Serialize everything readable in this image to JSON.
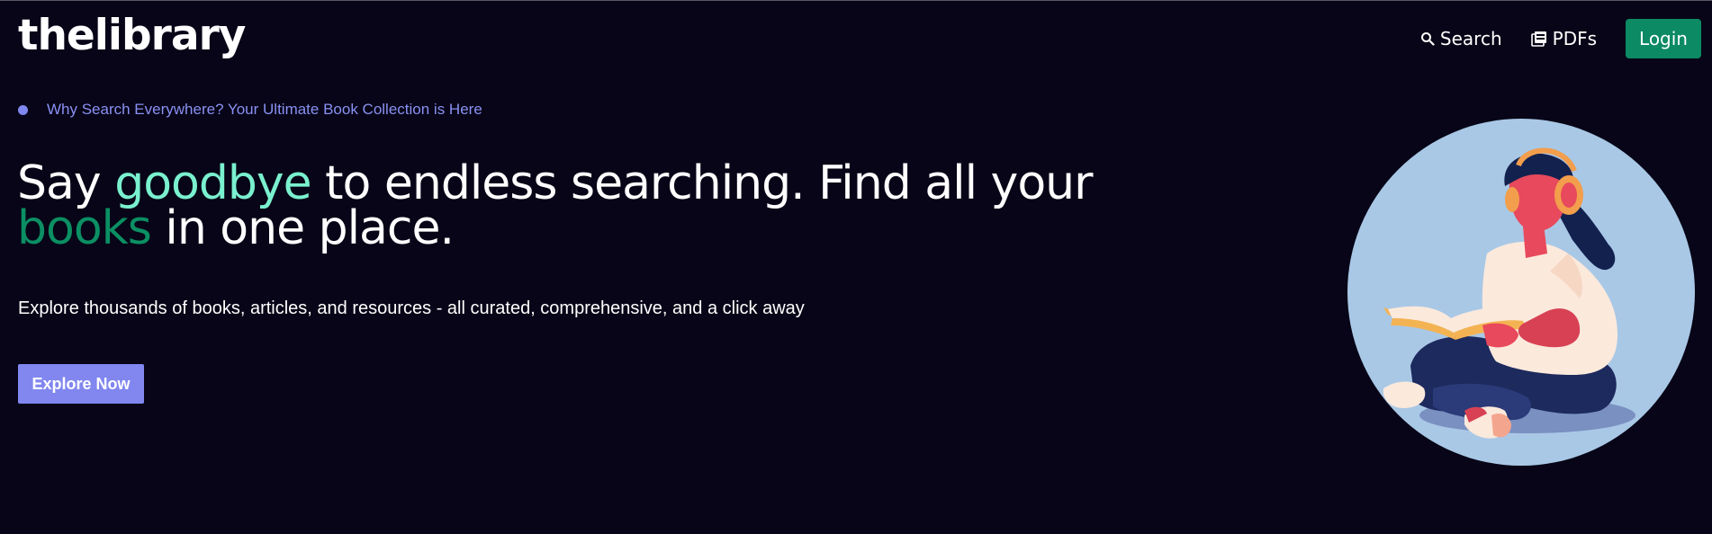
{
  "header": {
    "logo": "thelibrary",
    "nav": {
      "search_label": "Search",
      "pdfs_label": "PDFs",
      "login_label": "Login"
    }
  },
  "hero": {
    "tagline": "Why Search Everywhere? Your Ultimate Book Collection is Here",
    "headline": {
      "part1": "Say ",
      "highlight1": "goodbye",
      "part2": " to endless searching. Find all your",
      "highlight2": "books",
      "part3": " in one place."
    },
    "subtext": "Explore thousands of books, articles, and resources - all curated, comprehensive, and a click away",
    "cta_label": "Explore Now"
  },
  "icons": {
    "search": "search-icon",
    "pdf": "pdf-icon"
  },
  "colors": {
    "background": "#070517",
    "accent_green": "#0b8a63",
    "highlight_mint": "#7af0cf",
    "accent_purple": "#8187ef",
    "illustration_circle": "#a9c8e6"
  }
}
